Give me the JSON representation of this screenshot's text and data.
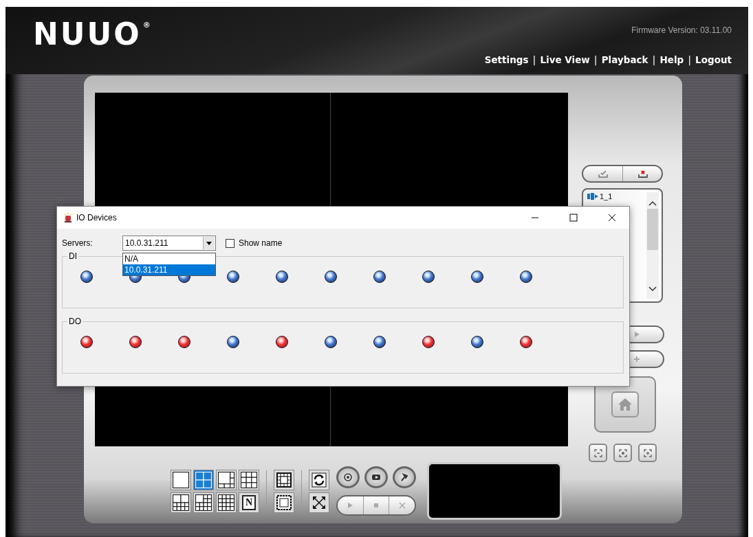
{
  "header": {
    "logo": "NUUO",
    "logo_mark": "®",
    "firmware": "Firmware Version: 03.11.00",
    "nav": [
      {
        "kind": "link",
        "label": "Settings"
      },
      {
        "kind": "separator",
        "label": "|"
      },
      {
        "kind": "link",
        "label": "Live View"
      },
      {
        "kind": "separator",
        "label": "|"
      },
      {
        "kind": "link",
        "label": "Playback"
      },
      {
        "kind": "separator",
        "label": "|"
      },
      {
        "kind": "link",
        "label": "Help"
      },
      {
        "kind": "separator",
        "label": "|"
      },
      {
        "kind": "link",
        "label": "Logout"
      }
    ]
  },
  "camera_list": {
    "items": [
      {
        "label": "1_1"
      }
    ]
  },
  "layout_buttons": [
    {
      "kind": "grid1",
      "selected": false
    },
    {
      "kind": "grid4",
      "selected": true
    },
    {
      "kind": "grid6",
      "selected": false
    },
    {
      "kind": "grid9",
      "selected": false
    },
    {
      "kind": "grid10",
      "selected": false
    },
    {
      "kind": "grid13",
      "selected": false
    },
    {
      "kind": "grid16",
      "selected": false
    },
    {
      "kind": "named",
      "label": "N",
      "selected": false
    }
  ],
  "dialog": {
    "title": "IO Devices",
    "servers_label": "Servers:",
    "server_value": "10.0.31.211",
    "show_name": {
      "label": "Show name",
      "checked": false
    },
    "dropdown_options": [
      {
        "label": "N/A",
        "selected": false
      },
      {
        "label": "10.0.31.211",
        "selected": true
      }
    ],
    "groups": [
      {
        "label": "DI",
        "leds": [
          {
            "active": false
          },
          {
            "active": false
          },
          {
            "active": false
          },
          {
            "active": false
          },
          {
            "active": false
          },
          {
            "active": false
          },
          {
            "active": false
          },
          {
            "active": false
          },
          {
            "active": false
          },
          {
            "active": false
          }
        ]
      },
      {
        "label": "DO",
        "leds": [
          {
            "active": true
          },
          {
            "active": true
          },
          {
            "active": true
          },
          {
            "active": false
          },
          {
            "active": true
          },
          {
            "active": false
          },
          {
            "active": false
          },
          {
            "active": true
          },
          {
            "active": false
          },
          {
            "active": true
          }
        ]
      }
    ]
  }
}
